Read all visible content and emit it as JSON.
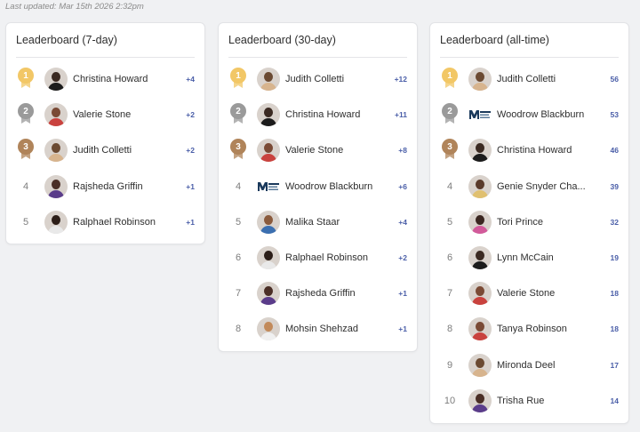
{
  "last_updated": "Last updated: Mar 15th 2026 2:32pm",
  "colors": {
    "gold": "#f2c766",
    "silver": "#9a9a9a",
    "bronze": "#b0845a",
    "score": "#4a5ea8"
  },
  "medal_labels": [
    "1",
    "2",
    "3"
  ],
  "boards": [
    {
      "title": "Leaderboard (7-day)",
      "rows": [
        {
          "rank": "1",
          "name": "Christina Howard",
          "score": "+4"
        },
        {
          "rank": "2",
          "name": "Valerie Stone",
          "score": "+2"
        },
        {
          "rank": "3",
          "name": "Judith Colletti",
          "score": "+2"
        },
        {
          "rank": "4",
          "name": "Rajsheda Griffin",
          "score": "+1"
        },
        {
          "rank": "5",
          "name": "Ralphael Robinson",
          "score": "+1"
        }
      ]
    },
    {
      "title": "Leaderboard (30-day)",
      "rows": [
        {
          "rank": "1",
          "name": "Judith Colletti",
          "score": "+12"
        },
        {
          "rank": "2",
          "name": "Christina Howard",
          "score": "+11"
        },
        {
          "rank": "3",
          "name": "Valerie Stone",
          "score": "+8"
        },
        {
          "rank": "4",
          "name": "Woodrow Blackburn",
          "score": "+6"
        },
        {
          "rank": "5",
          "name": "Malika Staar",
          "score": "+4"
        },
        {
          "rank": "6",
          "name": "Ralphael Robinson",
          "score": "+2"
        },
        {
          "rank": "7",
          "name": "Rajsheda Griffin",
          "score": "+1"
        },
        {
          "rank": "8",
          "name": "Mohsin Shehzad",
          "score": "+1"
        }
      ]
    },
    {
      "title": "Leaderboard (all-time)",
      "rows": [
        {
          "rank": "1",
          "name": "Judith Colletti",
          "score": "56"
        },
        {
          "rank": "2",
          "name": "Woodrow Blackburn",
          "score": "53"
        },
        {
          "rank": "3",
          "name": "Christina Howard",
          "score": "46"
        },
        {
          "rank": "4",
          "name": "Genie Snyder Cha...",
          "score": "39"
        },
        {
          "rank": "5",
          "name": "Tori Prince",
          "score": "32"
        },
        {
          "rank": "6",
          "name": "Lynn McCain",
          "score": "19"
        },
        {
          "rank": "7",
          "name": "Valerie Stone",
          "score": "18"
        },
        {
          "rank": "8",
          "name": "Tanya Robinson",
          "score": "18"
        },
        {
          "rank": "9",
          "name": "Mironda Deel",
          "score": "17"
        },
        {
          "rank": "10",
          "name": "Trisha Rue",
          "score": "14"
        }
      ]
    }
  ]
}
